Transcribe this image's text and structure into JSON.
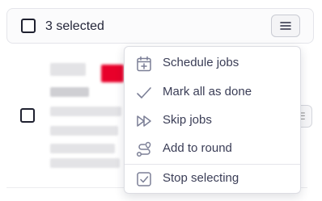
{
  "toolbar": {
    "selected_label": "3 selected",
    "menu_icon": "hamburger-icon"
  },
  "dropdown": {
    "items": [
      {
        "label": "Schedule jobs",
        "icon": "calendar-plus-icon"
      },
      {
        "label": "Mark all as done",
        "icon": "check-icon"
      },
      {
        "label": "Skip jobs",
        "icon": "skip-forward-icon"
      },
      {
        "label": "Add to round",
        "icon": "route-icon"
      },
      {
        "label": "Stop selecting",
        "icon": "checkbox-checked-icon"
      }
    ]
  },
  "colors": {
    "text": "#3a3d56",
    "icon": "#7b7f96",
    "border": "#dcdde3",
    "accent_red": "#e8002a"
  }
}
